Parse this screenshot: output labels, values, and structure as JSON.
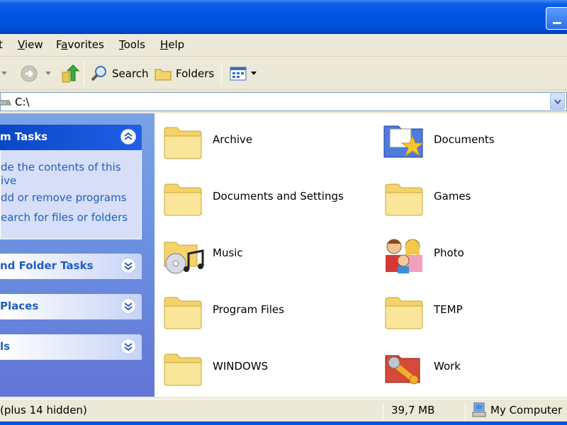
{
  "menu": [
    {
      "label": "t",
      "accel": ""
    },
    {
      "label": "View",
      "accel": "V"
    },
    {
      "label": "Favorites",
      "accel": "a"
    },
    {
      "label": "Tools",
      "accel": "T"
    },
    {
      "label": "Help",
      "accel": "H"
    }
  ],
  "toolbar": {
    "search_label": "Search",
    "folders_label": "Folders"
  },
  "address": {
    "value": "C:\\"
  },
  "taskpane": {
    "system_tasks": {
      "title": "m Tasks",
      "links": [
        "de the contents of this",
        "ive",
        "dd or remove programs",
        "earch for files or folders"
      ]
    },
    "file_folder_tasks": {
      "title": "nd Folder Tasks"
    },
    "other_places": {
      "title": " Places"
    },
    "details": {
      "title": "ls"
    }
  },
  "items": [
    {
      "label": "Archive",
      "icon": "folder-icon"
    },
    {
      "label": "Documents",
      "icon": "my-documents-icon"
    },
    {
      "label": "Documents and Settings",
      "icon": "folder-icon"
    },
    {
      "label": "Games",
      "icon": "folder-icon"
    },
    {
      "label": "Music",
      "icon": "music-folder-icon"
    },
    {
      "label": "Photo",
      "icon": "photo-people-icon"
    },
    {
      "label": "Program Files",
      "icon": "folder-icon"
    },
    {
      "label": "TEMP",
      "icon": "folder-icon"
    },
    {
      "label": "WINDOWS",
      "icon": "folder-icon"
    },
    {
      "label": "Work",
      "icon": "work-tools-icon"
    }
  ],
  "status": {
    "objects": "(plus 14 hidden)",
    "size": "39,7 MB",
    "zone": "My Computer"
  },
  "colors": {
    "titlebar": "#0054e3",
    "taskpane": "#7ba2e7",
    "link": "#215dc6",
    "folder": "#f4d36a"
  }
}
